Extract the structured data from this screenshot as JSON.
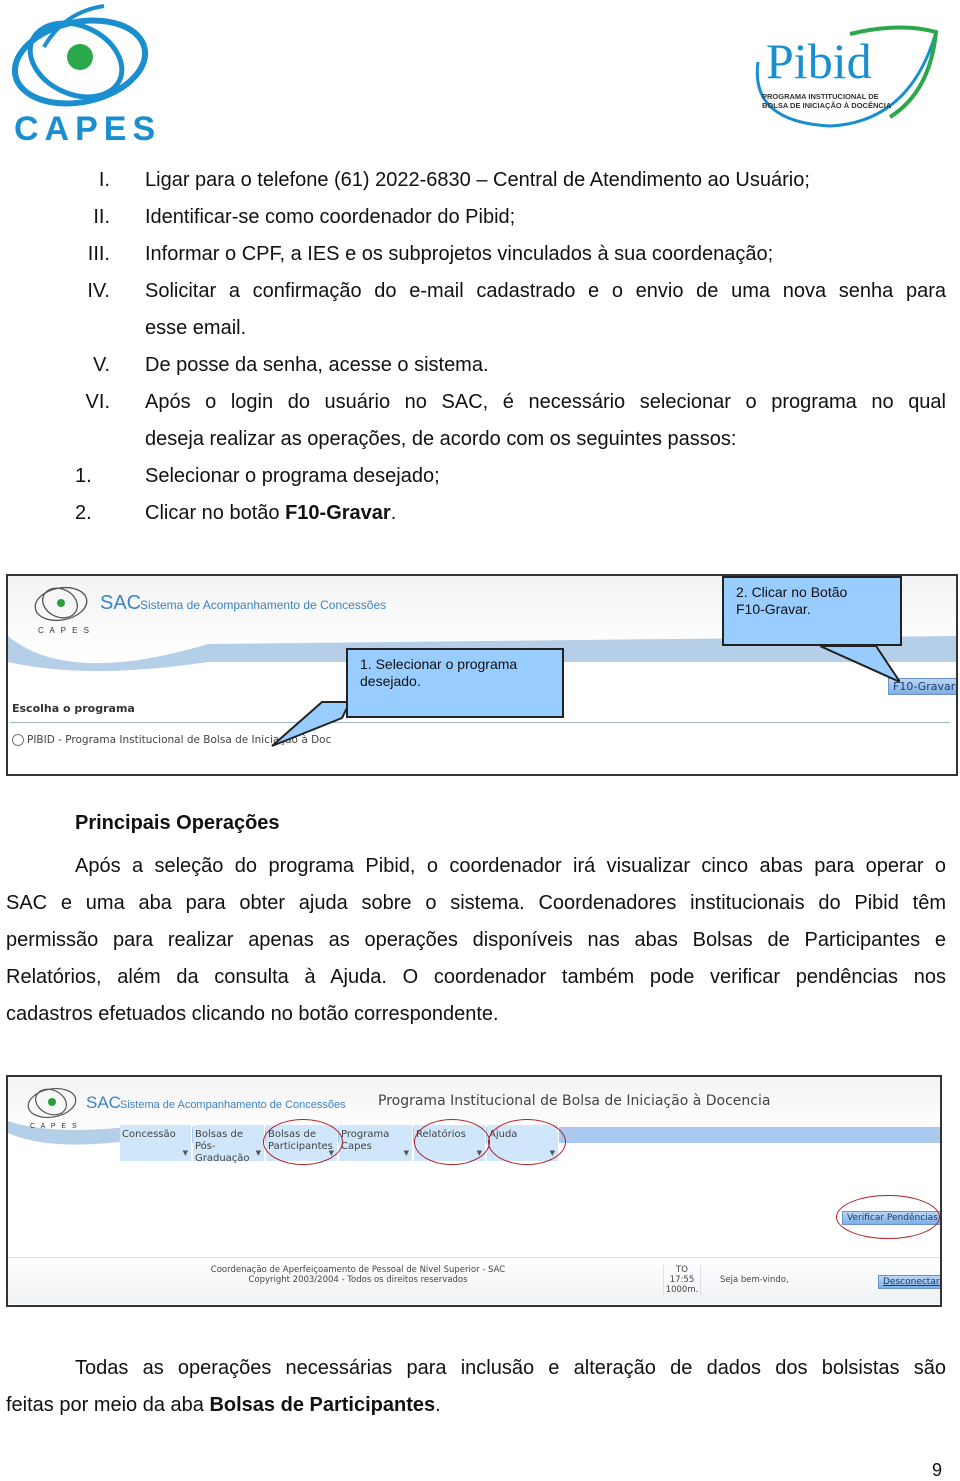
{
  "header": {
    "left_logo": {
      "icon": "capes-logo-icon",
      "text": "CAPES"
    },
    "right_logo": {
      "icon": "pibid-logo-icon",
      "text": "Pibid",
      "subtitle_line1": "PROGRAMA INSTITUCIONAL DE",
      "subtitle_line2": "BOLSA DE INICIAÇÃO À DOCÊNCIA"
    }
  },
  "steps_roman": [
    {
      "num": "I.",
      "text": "Ligar para o telefone (61) 2022-6830 – Central de Atendimento ao Usuário;"
    },
    {
      "num": "II.",
      "text": "Identificar-se como coordenador do Pibid;"
    },
    {
      "num": "III.",
      "text": "Informar o CPF, a IES e os subprojetos vinculados à sua coordenação;"
    },
    {
      "num": "IV.",
      "text": "Solicitar a confirmação do e-mail cadastrado e o envio de uma nova senha para",
      "text_cont": "esse email."
    },
    {
      "num": "V.",
      "text": "De posse da senha, acesse o sistema."
    },
    {
      "num": "VI.",
      "text": "Após o login do usuário no SAC, é necessário selecionar o programa no qual",
      "text_cont": "deseja realizar as operações, de acordo com os seguintes passos:"
    }
  ],
  "steps_numbered": [
    {
      "num": "1.",
      "text": "Selecionar o programa desejado;"
    },
    {
      "num": "2.",
      "text_prefix": "Clicar no botão ",
      "text_bold": "F10-Gravar",
      "text_suffix": "."
    }
  ],
  "screenshot1": {
    "logo_text": "C A P E S",
    "sac": "SAC",
    "sac_subtitle": "Sistema de Acompanhamento de Concessões",
    "section_label": "Escolha o programa",
    "radio_option": "PIBID - Programa Institucional de Bolsa de Iniciação à Doc",
    "save_button": "F10-Gravar",
    "callout1_line1": "1. Selecionar o programa",
    "callout1_line2": "desejado.",
    "callout2_line1": "2. Clicar no Botão",
    "callout2_line2": "F10-Gravar."
  },
  "section": {
    "title": "Principais Operações",
    "paragraph_lines": [
      "Após a seleção do programa Pibid, o coordenador irá visualizar cinco abas para operar o",
      "SAC e uma aba para obter ajuda sobre o sistema. Coordenadores institucionais do Pibid têm",
      "permissão para realizar apenas as operações disponíveis nas abas Bolsas de Participantes e",
      "Relatórios, além da consulta à Ajuda. O coordenador também pode verificar pendências nos",
      "cadastros efetuados clicando no botão correspondente."
    ]
  },
  "screenshot2": {
    "logo_text": "C A P E S",
    "sac": "SAC",
    "sac_subtitle": "Sistema de Acompanhamento de Concessões",
    "program_title": "Programa Institucional de Bolsa de Iniciação à Docencia",
    "tabs": [
      {
        "line1": "Concessão",
        "line2": "",
        "highlighted": false
      },
      {
        "line1": "Bolsas de",
        "line2": "Pós-Graduação",
        "highlighted": false
      },
      {
        "line1": "Bolsas de",
        "line2": "Participantes",
        "highlighted": true
      },
      {
        "line1": "Programa Capes",
        "line2": "",
        "highlighted": false
      },
      {
        "line1": "Relatórios",
        "line2": "",
        "highlighted": true
      },
      {
        "line1": "Ajuda",
        "line2": "",
        "highlighted": true
      }
    ],
    "verify_button": "Verificar Pendências",
    "footer_line1": "Coordenação de Aperfeiçoamento de Pessoal de Nível Superior - SAC",
    "footer_line2": "Copyright 2003/2004 - Todos os direitos reservados",
    "footer_state": "TO",
    "footer_time": "17:55",
    "footer_timeout": "1000m.",
    "welcome": "Seja bem-vindo,",
    "disconnect": "Desconectar"
  },
  "closing": {
    "line1": "Todas as operações necessárias para inclusão e alteração de dados dos bolsistas são",
    "line2_prefix": "feitas por meio da aba ",
    "line2_bold": "Bolsas de Participantes",
    "line2_suffix": "."
  },
  "page_number": "9",
  "colors": {
    "brand_blue": "#1a8fd0",
    "brand_green": "#2aa84a",
    "callout_fill": "#99ccff",
    "highlight_red": "#b0202a"
  }
}
